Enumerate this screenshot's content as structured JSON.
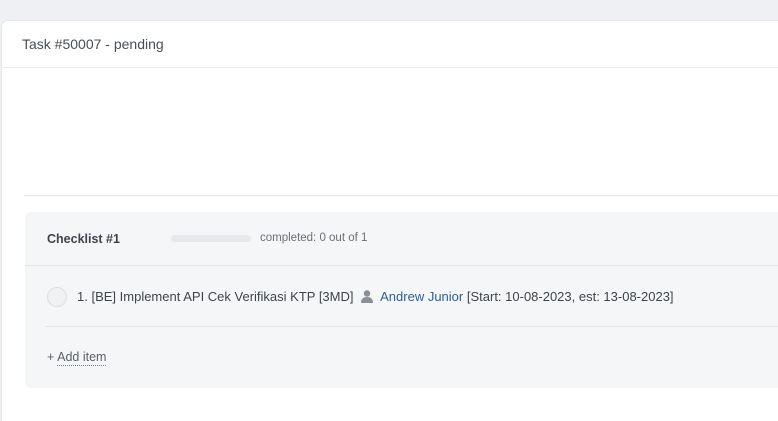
{
  "task": {
    "title": "Task #50007 - pending"
  },
  "checklist": {
    "title": "Checklist #1",
    "progress_fraction": 0,
    "progress_text": "completed: 0 out of 1",
    "colors": {
      "progress_fill": "#4a90e2",
      "assignee_link": "#2c5f96"
    },
    "items": [
      {
        "number": "1.",
        "text": "[BE] Implement API Cek Verifikasi KTP [3MD]",
        "assignee_icon": "user-icon",
        "assignee": "Andrew Junior",
        "dates": "[Start: 10-08-2023, est: 13-08-2023]",
        "checked": false
      }
    ],
    "add_item_prefix": "+",
    "add_item_label": "Add item"
  }
}
